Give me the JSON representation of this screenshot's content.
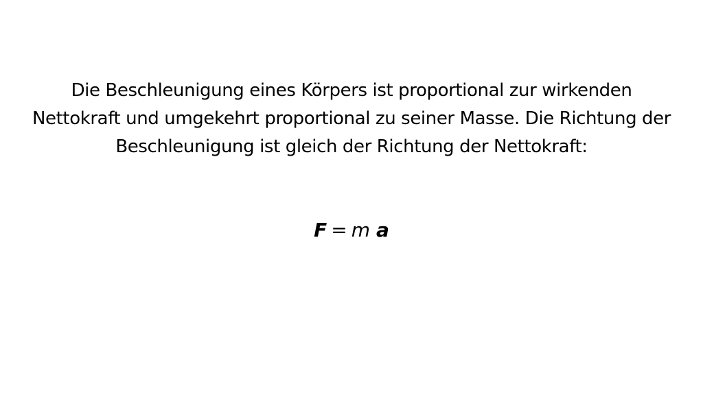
{
  "law_text": "Die Beschleunigung eines Körpers ist proportional zur wirkenden Nettokraft und umgekehrt proportional zu seiner Masse. Die Richtung der Beschleunigung ist gleich der Richtung der Nettokraft:",
  "formula": {
    "force": "F",
    "equals": "=",
    "mass": "m",
    "acceleration": "a"
  }
}
